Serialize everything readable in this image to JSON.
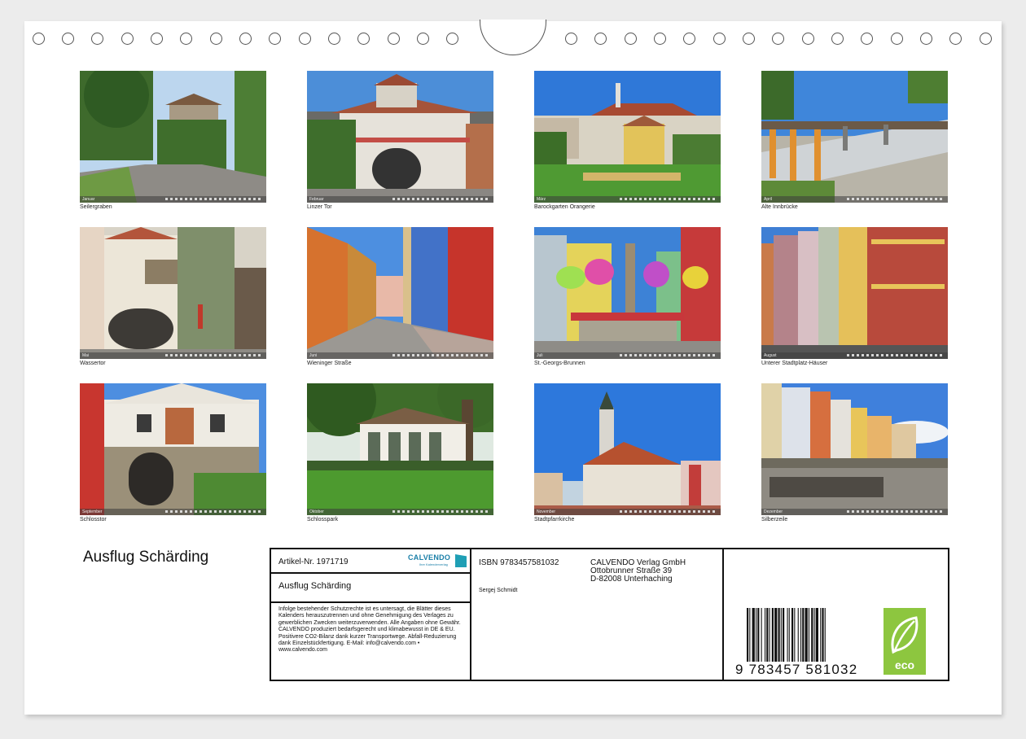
{
  "calendar": {
    "title": "Ausflug Schärding",
    "months": [
      {
        "month_label": "Januar",
        "caption": "Seilergraben"
      },
      {
        "month_label": "Februar",
        "caption": "Linzer Tor"
      },
      {
        "month_label": "März",
        "caption": "Barockgarten Orangerie"
      },
      {
        "month_label": "April",
        "caption": "Alte Innbrücke"
      },
      {
        "month_label": "Mai",
        "caption": "Wassertor"
      },
      {
        "month_label": "Juni",
        "caption": "Wieninger Straße"
      },
      {
        "month_label": "Juli",
        "caption": "St.-Georgs-Brunnen"
      },
      {
        "month_label": "August",
        "caption": "Unterer Stadtplatz-Häuser"
      },
      {
        "month_label": "September",
        "caption": "Schlosstor"
      },
      {
        "month_label": "Oktober",
        "caption": "Schlosspark"
      },
      {
        "month_label": "November",
        "caption": "Stadtpfarrkirche"
      },
      {
        "month_label": "Dezember",
        "caption": "Silberzeile"
      }
    ]
  },
  "info_box": {
    "article_no": "Artikel-Nr. 1971719",
    "logo_text": "CALVENDO",
    "logo_sub": "Ihre Kalenderverlag",
    "product_title": "Ausflug Schärding",
    "legal_text": "Infolge bestehender Schutzrechte ist es untersagt, die Blätter dieses Kalenders herauszutrennen und ohne Genehmigung des Verlages zu gewerblichen Zwecken weiterzuverwenden. Alle Angaben ohne Gewähr. CALVENDO produziert bedarfsgerecht und klimabewusst in DE & EU. Positivere CO2-Bilanz dank kurzer Transportwege. Abfall-Reduzierung dank Einzelstückfertigung. E-Mail: info@calvendo.com • www.calvendo.com",
    "isbn": "ISBN 9783457581032",
    "author": "Sergej Schmidt",
    "publisher": {
      "line1": "CALVENDO Verlag GmbH",
      "line2": "Ottobrunner Straße 39",
      "line3": "D-82008 Unterhaching"
    },
    "barcode_number": "9  783457  581032",
    "eco_label": "eco"
  },
  "colors": {
    "eco_green": "#8dc63f",
    "calvendo_blue": "#1a7fa8"
  }
}
